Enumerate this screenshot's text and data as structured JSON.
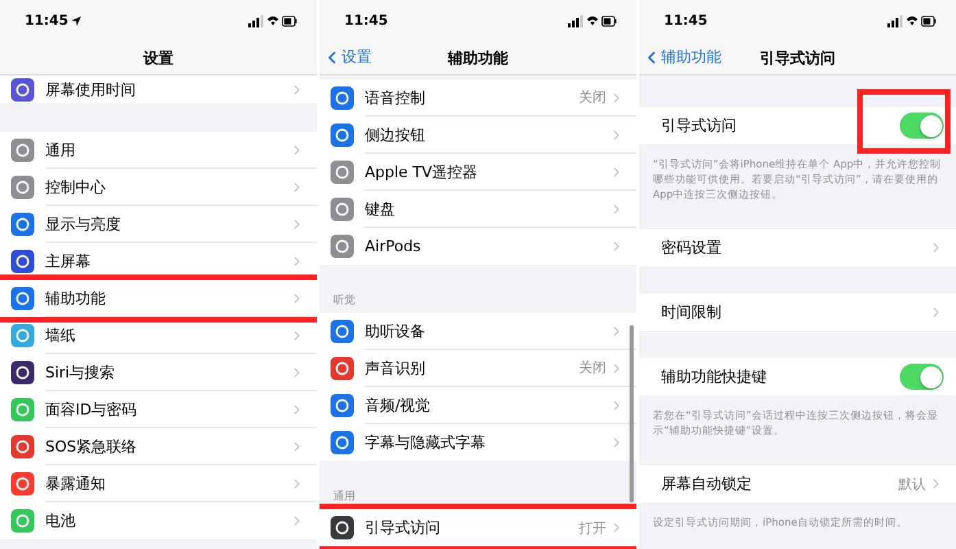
{
  "panels": [
    {
      "status_bar": {
        "time": "11:45",
        "location": true
      },
      "nav": {
        "title": "设置"
      },
      "sections": [
        {
          "rows": [
            {
              "label": "屏幕使用时间",
              "color": "#5856d6",
              "kind": "link"
            }
          ]
        },
        {
          "rows": [
            {
              "label": "通用",
              "color": "#8e8e93",
              "kind": "link"
            },
            {
              "label": "控制中心",
              "color": "#8e8e93",
              "kind": "link"
            },
            {
              "label": "显示与亮度",
              "color": "#1a73e8",
              "kind": "link"
            },
            {
              "label": "主屏幕",
              "color": "#2d4fd6",
              "kind": "link"
            },
            {
              "label": "辅助功能",
              "color": "#1a73e8",
              "kind": "link",
              "highlighted": true
            },
            {
              "label": "墙纸",
              "color": "#35aadc",
              "kind": "link"
            },
            {
              "label": "Siri与搜索",
              "color": "#3a2a6b",
              "kind": "link"
            },
            {
              "label": "面容ID与密码",
              "color": "#34c759",
              "kind": "link"
            },
            {
              "label": "SOS紧急联络",
              "color": "#e5392f",
              "kind": "link"
            },
            {
              "label": "暴露通知",
              "color": "#ff3b30",
              "kind": "link"
            },
            {
              "label": "电池",
              "color": "#34c759",
              "kind": "link"
            }
          ]
        }
      ]
    },
    {
      "status_bar": {
        "time": "11:45",
        "location": false
      },
      "nav": {
        "back": "设置",
        "title": "辅助功能"
      },
      "sections": [
        {
          "rows": [
            {
              "label": "语音控制",
              "color": "#1a73e8",
              "kind": "link",
              "value": "关闭"
            },
            {
              "label": "侧边按钮",
              "color": "#1a73e8",
              "kind": "link"
            },
            {
              "label": "Apple TV遥控器",
              "color": "#8e8e93",
              "kind": "link"
            },
            {
              "label": "键盘",
              "color": "#8e8e93",
              "kind": "link"
            },
            {
              "label": "AirPods",
              "color": "#8e8e93",
              "kind": "link"
            }
          ]
        },
        {
          "header": "听觉",
          "rows": [
            {
              "label": "助听设备",
              "color": "#1a73e8",
              "kind": "link"
            },
            {
              "label": "声音识别",
              "color": "#e5392f",
              "kind": "link",
              "value": "关闭"
            },
            {
              "label": "音频/视觉",
              "color": "#1a73e8",
              "kind": "link"
            },
            {
              "label": "字幕与隐藏式字幕",
              "color": "#1a73e8",
              "kind": "link"
            }
          ]
        },
        {
          "header": "通用",
          "rows": [
            {
              "label": "引导式访问",
              "color": "#3a3a3c",
              "kind": "link",
              "value": "打开",
              "highlighted": true
            }
          ]
        }
      ]
    },
    {
      "status_bar": {
        "time": "11:45",
        "location": false
      },
      "nav": {
        "back": "辅助功能",
        "title": "引导式访问"
      },
      "sections": [
        {
          "rows": [
            {
              "label": "引导式访问",
              "kind": "toggle",
              "on": true,
              "highlighted": true
            }
          ],
          "footer": "“引导式访问”会将iPhone维持在单个 App中，并允许您控制哪些功能可供使用。若要启动“引导式访问”，请在要使用的App中连按三次侧边按钮。"
        },
        {
          "rows": [
            {
              "label": "密码设置",
              "kind": "link"
            }
          ]
        },
        {
          "rows": [
            {
              "label": "时间限制",
              "kind": "link"
            }
          ]
        },
        {
          "rows": [
            {
              "label": "辅助功能快捷键",
              "kind": "toggle",
              "on": true
            }
          ],
          "footer": "若您在“引导式访问”会话过程中连按三次侧边按钮，将会显示“辅助功能快捷键”设置。"
        },
        {
          "rows": [
            {
              "label": "屏幕自动锁定",
              "kind": "link",
              "value": "默认"
            }
          ],
          "footer": "设定引导式访问期间，iPhone自动锁定所需的时间。"
        }
      ]
    }
  ]
}
